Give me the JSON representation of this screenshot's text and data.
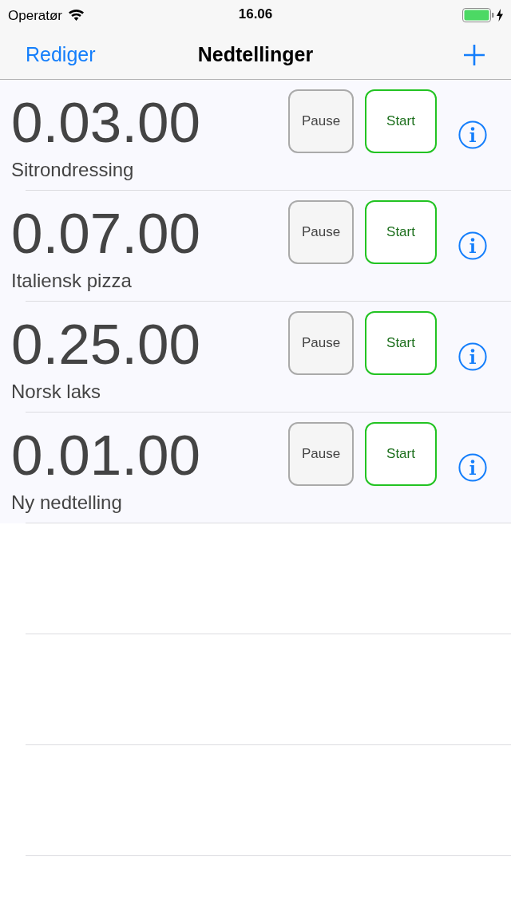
{
  "status_bar": {
    "carrier": "Operatør",
    "time": "16.06"
  },
  "nav_bar": {
    "left_button": "Rediger",
    "title": "Nedtellinger"
  },
  "timers": [
    {
      "time": "0.03.00",
      "name": "Sitrondressing",
      "pause_label": "Pause",
      "start_label": "Start"
    },
    {
      "time": "0.07.00",
      "name": "Italiensk pizza",
      "pause_label": "Pause",
      "start_label": "Start"
    },
    {
      "time": "0.25.00",
      "name": "Norsk laks",
      "pause_label": "Pause",
      "start_label": "Start"
    },
    {
      "time": "0.01.00",
      "name": "Ny nedtelling",
      "pause_label": "Pause",
      "start_label": "Start"
    }
  ]
}
